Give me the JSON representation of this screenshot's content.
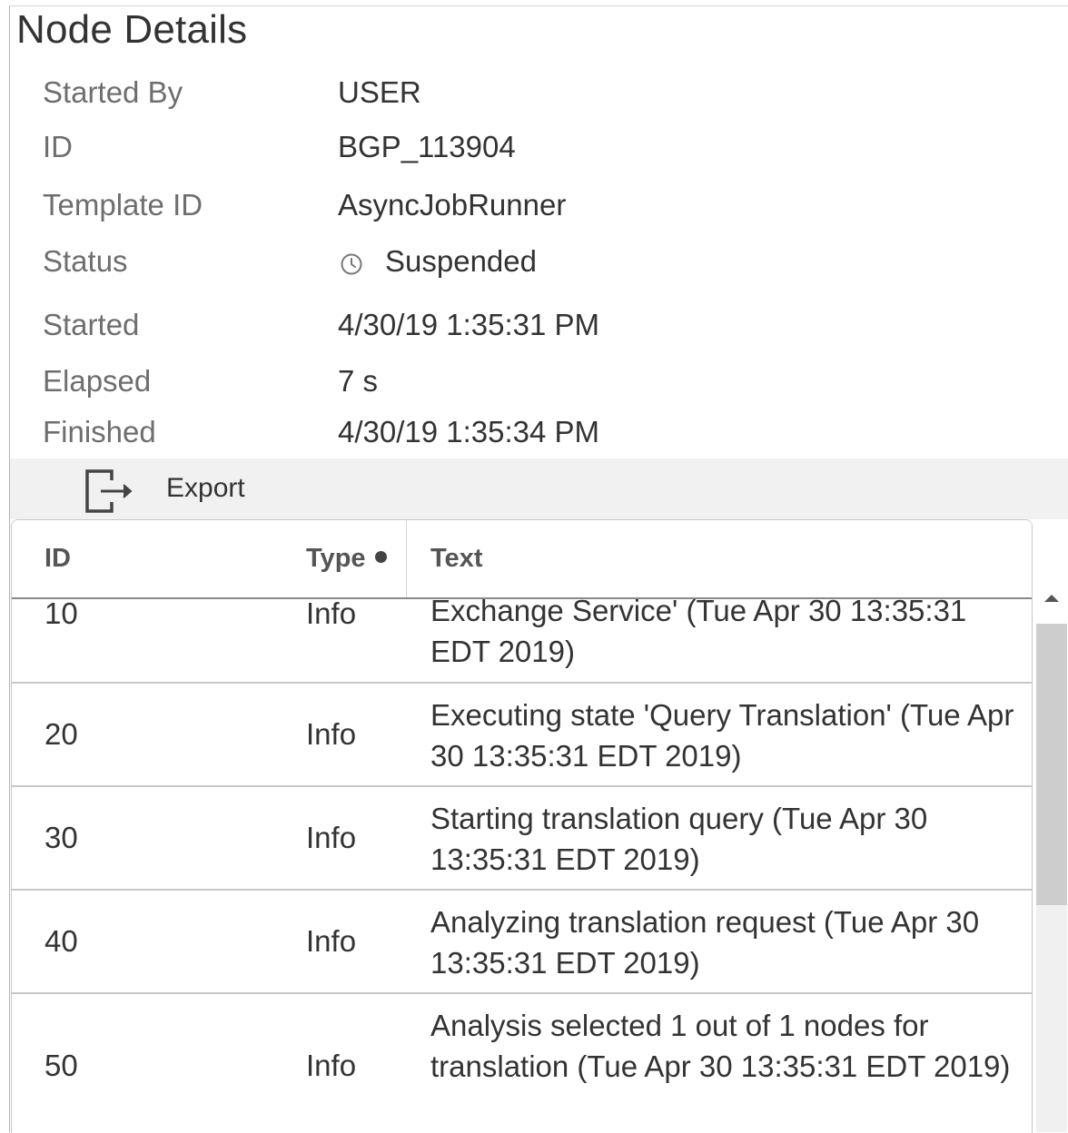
{
  "panel": {
    "title": "Node Details"
  },
  "properties": {
    "started_by": {
      "label": "Started By",
      "value": "USER"
    },
    "id": {
      "label": "ID",
      "value": "BGP_113904"
    },
    "template_id": {
      "label": "Template ID",
      "value": "AsyncJobRunner"
    },
    "status": {
      "label": "Status",
      "value": "Suspended",
      "icon": "clock-icon"
    },
    "started": {
      "label": "Started",
      "value": "4/30/19 1:35:31 PM"
    },
    "elapsed": {
      "label": "Elapsed",
      "value": "7 s"
    },
    "finished": {
      "label": "Finished",
      "value": "4/30/19 1:35:34 PM"
    }
  },
  "toolbar": {
    "export_label": "Export",
    "export_icon": "export-icon"
  },
  "table": {
    "columns": [
      "ID",
      "Type",
      "Text"
    ],
    "rows": [
      {
        "id": "10",
        "type": "Info",
        "text": "Exchange Service' (Tue Apr 30 13:35:31 EDT 2019)"
      },
      {
        "id": "20",
        "type": "Info",
        "text": "Executing state 'Query Translation' (Tue Apr 30 13:35:31 EDT 2019)"
      },
      {
        "id": "30",
        "type": "Info",
        "text": "Starting translation query (Tue Apr 30 13:35:31 EDT 2019)"
      },
      {
        "id": "40",
        "type": "Info",
        "text": "Analyzing translation request (Tue Apr 30 13:35:31 EDT 2019)"
      },
      {
        "id": "50",
        "type": "Info",
        "text": "Analysis selected 1 out of 1 nodes for translation (Tue Apr 30 13:35:31 EDT 2019)"
      }
    ]
  }
}
